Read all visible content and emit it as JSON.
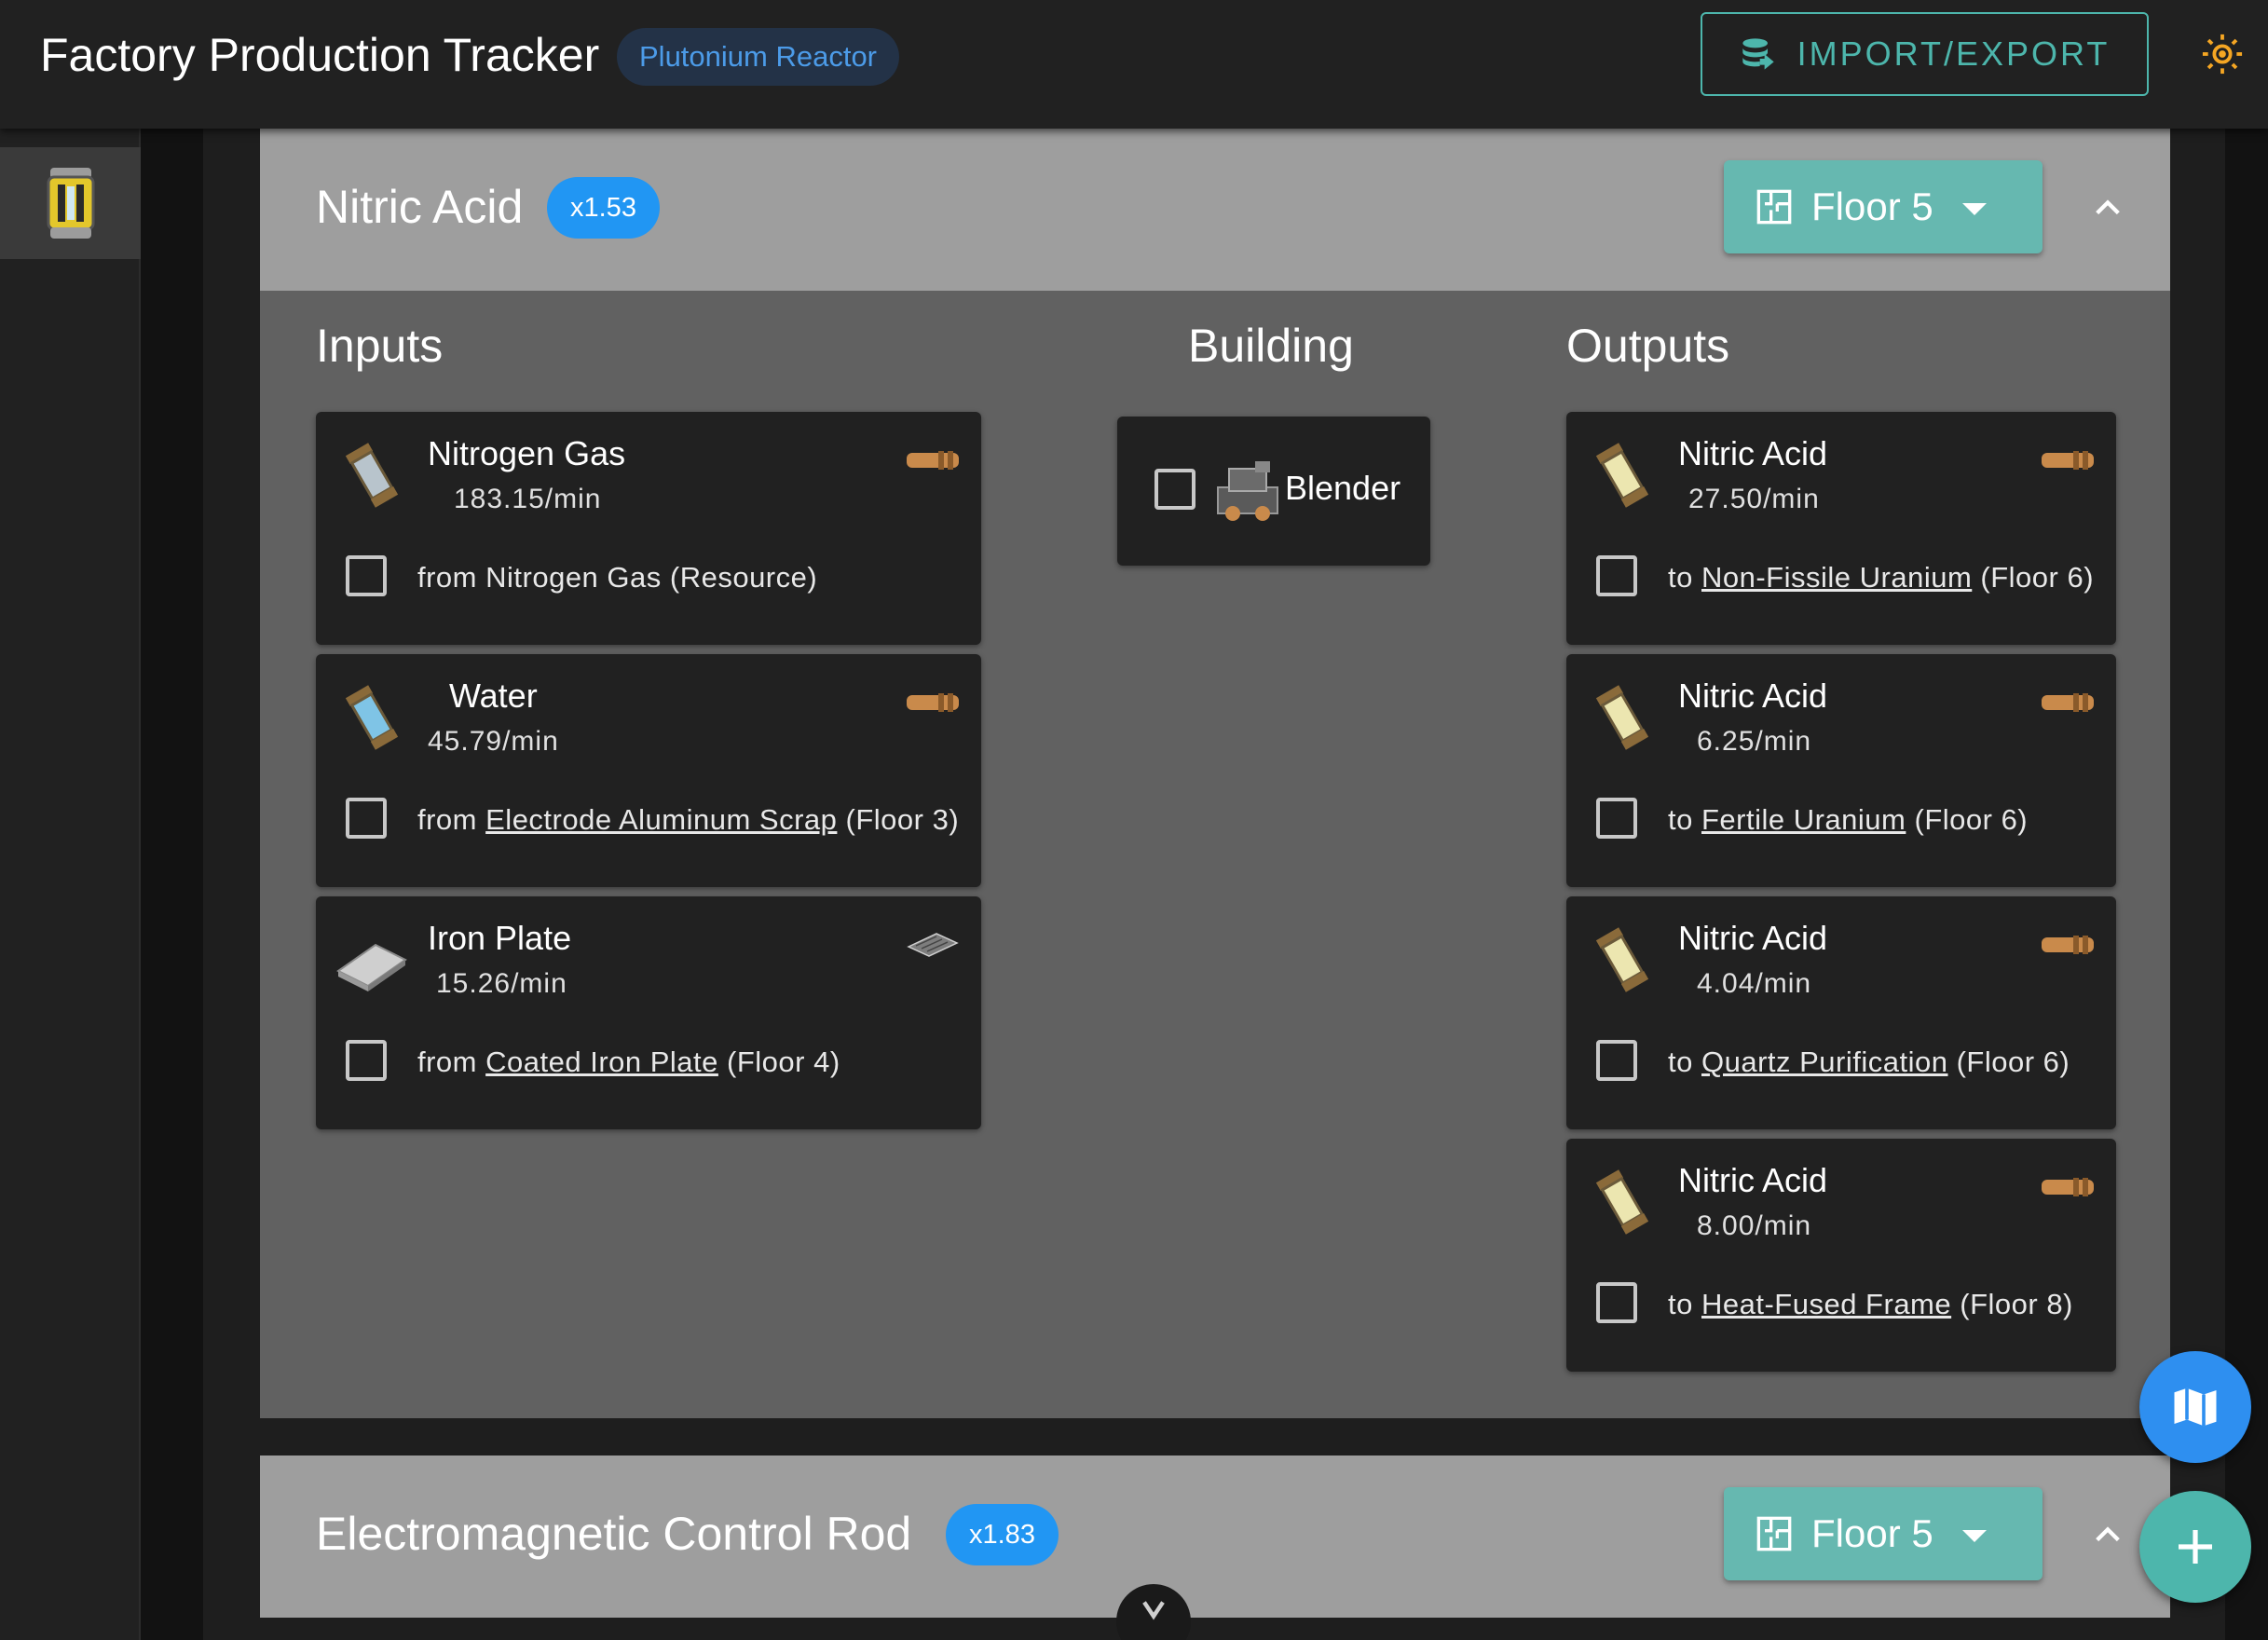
{
  "app": {
    "title": "Factory Production Tracker",
    "plan_chip": "Plutonium Reactor",
    "import_export_label": "IMPORT/EXPORT",
    "theme_icon": "sun-icon"
  },
  "colors": {
    "accent_teal": "#4db6ac",
    "chip_blue": "#2196f3",
    "header_grey": "#9e9e9e",
    "body_grey": "#616161",
    "card_dark": "#212121",
    "theme_icon_orange": "#f5a623"
  },
  "groups": [
    {
      "title": "Nitric Acid",
      "multiplier": "x1.53",
      "floor_label": "Floor 5",
      "headings": {
        "inputs": "Inputs",
        "building": "Building",
        "outputs": "Outputs"
      },
      "building": {
        "name": "Blender"
      },
      "inputs": [
        {
          "name": "Nitrogen Gas",
          "rate": "183.15/min",
          "prefix": "from",
          "link": "",
          "plain": "Nitrogen Gas (Resource)",
          "suffix": ""
        },
        {
          "name": "Water",
          "rate": "45.79/min",
          "prefix": "from",
          "link": "Electrode Aluminum Scrap",
          "plain": "",
          "suffix": "(Floor 3)"
        },
        {
          "name": "Iron Plate",
          "rate": "15.26/min",
          "prefix": "from",
          "link": "Coated Iron Plate",
          "plain": "",
          "suffix": "(Floor 4)"
        }
      ],
      "outputs": [
        {
          "name": "Nitric Acid",
          "rate": "27.50/min",
          "prefix": "to",
          "link": "Non-Fissile Uranium",
          "suffix": "(Floor 6)"
        },
        {
          "name": "Nitric Acid",
          "rate": "6.25/min",
          "prefix": "to",
          "link": "Fertile Uranium",
          "suffix": "(Floor 6)"
        },
        {
          "name": "Nitric Acid",
          "rate": "4.04/min",
          "prefix": "to",
          "link": "Quartz Purification",
          "suffix": "(Floor 6)"
        },
        {
          "name": "Nitric Acid",
          "rate": "8.00/min",
          "prefix": "to",
          "link": "Heat-Fused Frame",
          "suffix": "(Floor 8)"
        }
      ]
    },
    {
      "title": "Electromagnetic Control Rod",
      "multiplier": "x1.83",
      "floor_label": "Floor 5"
    }
  ]
}
